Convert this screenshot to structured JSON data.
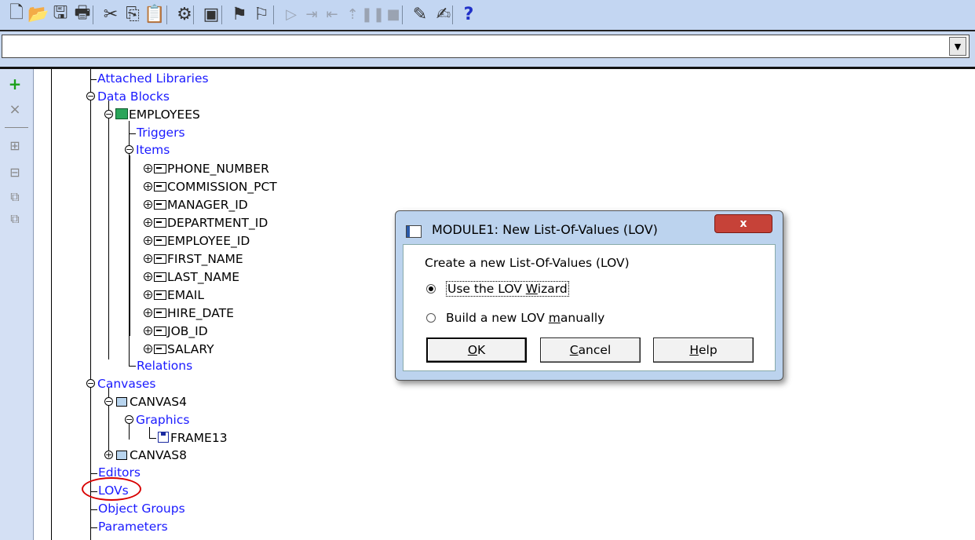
{
  "toolbar": {
    "buttons": [
      {
        "name": "new-icon",
        "glyph": "🗋"
      },
      {
        "name": "open-icon",
        "glyph": "📂"
      },
      {
        "name": "save-icon",
        "glyph": "🖫"
      },
      {
        "name": "print-icon",
        "glyph": "🖶"
      },
      {
        "name": "cut-icon",
        "glyph": "✂"
      },
      {
        "name": "copy-icon",
        "glyph": "⎘"
      },
      {
        "name": "paste-icon",
        "glyph": "📋"
      },
      {
        "name": "compile-icon",
        "glyph": "⚙"
      },
      {
        "name": "run-form-icon",
        "glyph": "▣"
      },
      {
        "name": "run-debug-icon",
        "glyph": "⚑"
      },
      {
        "name": "run-web-icon",
        "glyph": "⚐"
      },
      {
        "name": "go-icon",
        "glyph": "▷"
      },
      {
        "name": "step-into-icon",
        "glyph": "⇥"
      },
      {
        "name": "step-over-icon",
        "glyph": "⇤"
      },
      {
        "name": "step-out-icon",
        "glyph": "⇡"
      },
      {
        "name": "pause-icon",
        "glyph": "❚❚"
      },
      {
        "name": "stop-icon",
        "glyph": "■"
      },
      {
        "name": "layout-editor-icon",
        "glyph": "✎"
      },
      {
        "name": "pl-sql-editor-icon",
        "glyph": "✍"
      },
      {
        "name": "help-icon",
        "glyph": "?"
      }
    ]
  },
  "combo": {
    "value": "",
    "arrow": "▼"
  },
  "vertical_toolbar": {
    "create": "+",
    "delete": "×",
    "expand": "⊞",
    "collapse": "⊟",
    "expand_all": "⧉",
    "collapse_all": "⧉"
  },
  "tree": {
    "attached_libraries": "Attached Libraries",
    "data_blocks": "Data Blocks",
    "employees": "EMPLOYEES",
    "triggers": "Triggers",
    "items": "Items",
    "item_list": [
      "PHONE_NUMBER",
      "COMMISSION_PCT",
      "MANAGER_ID",
      "DEPARTMENT_ID",
      "EMPLOYEE_ID",
      "FIRST_NAME",
      "LAST_NAME",
      "EMAIL",
      "HIRE_DATE",
      "JOB_ID",
      "SALARY"
    ],
    "relations": "Relations",
    "canvases": "Canvases",
    "canvas4": "CANVAS4",
    "graphics": "Graphics",
    "frame13": "FRAME13",
    "canvas8": "CANVAS8",
    "editors": "Editors",
    "lovs": "LOVs",
    "object_groups": "Object Groups",
    "parameters": "Parameters",
    "expanded_glyph": "−",
    "collapsed_glyph": "+"
  },
  "dialog": {
    "title": "MODULE1: New List-Of-Values (LOV)",
    "close": "x",
    "heading": "Create a new List-Of-Values (LOV)",
    "option_wizard": "Use the LOV Wizard",
    "option_manual": "Build a new LOV manually",
    "selected": "wizard",
    "ok": "OK",
    "cancel": "Cancel",
    "help": "Help"
  }
}
